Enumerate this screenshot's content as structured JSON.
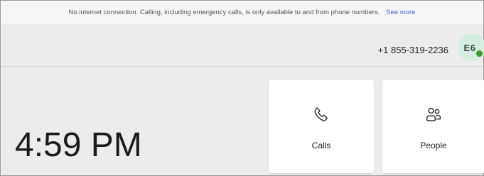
{
  "banner": {
    "message": "No internet connection. Calling, including emergency calls, is only available to and from phone numbers.",
    "link_label": "See more"
  },
  "header": {
    "phone_number": "+1 855-319-2236",
    "avatar_initials": "E6",
    "presence_status": "available"
  },
  "clock": {
    "time": "4:59 PM"
  },
  "tiles": [
    {
      "label": "Calls",
      "icon": "phone-icon"
    },
    {
      "label": "People",
      "icon": "people-icon"
    }
  ],
  "colors": {
    "accent_link": "#4a63c8",
    "presence_green": "#3c9e2c",
    "avatar_bg": "#d6eedf"
  }
}
